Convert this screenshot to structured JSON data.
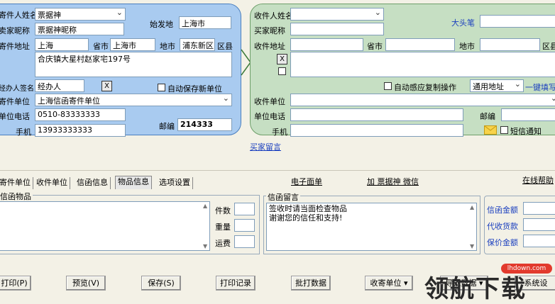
{
  "sender": {
    "name_label": "寄件人姓名",
    "name_value": "票据神",
    "nick_label": "卖家昵称",
    "nick_value": "票据神昵称",
    "origin_label": "始发地",
    "origin_value": "上海市",
    "addr_label": "寄件地址",
    "addr_value": "上海",
    "province_label": "省市",
    "province_value": "上海市",
    "area_label": "地市",
    "area_value": "浦东新区",
    "district_label": "区县",
    "detail_addr": "合庆镇大星村赵家宅197号",
    "handler_label": "经办人签名",
    "handler_value": "经办人",
    "x_label": "X",
    "autosave_label": "自动保存新单位",
    "unit_label": "寄件单位",
    "unit_value": "上海信函寄件单位",
    "phone_label": "单位电话",
    "phone_value": "0510-83333333",
    "mobile_label": "手机",
    "mobile_value": "13933333333",
    "zip_label": "邮编",
    "zip_value": "214333"
  },
  "receiver": {
    "name_label": "收件人姓名",
    "name_value": "",
    "buyer_label": "买家昵称",
    "buyer_value": "",
    "bignose_label": "大头笔",
    "bignose_value": "",
    "addr_label": "收件地址",
    "addr_value": "",
    "province_label": "省市",
    "area_label": "地市",
    "district_label": "区县",
    "x_label": "X",
    "autosense_label": "自动感应复制操作",
    "addr_type_value": "通用地址",
    "fill_link": "一键填写",
    "unit_label": "收件单位",
    "unit_value": "",
    "phone_label": "单位电话",
    "mobile_label": "手机",
    "zip_label": "邮编",
    "sms_label": "短信通知"
  },
  "buyer_message_link": "买家留言",
  "tabs": [
    {
      "label": "寄件单位"
    },
    {
      "label": "收件单位"
    },
    {
      "label": "信函信息"
    },
    {
      "label": "物品信息"
    },
    {
      "label": "选项设置"
    }
  ],
  "top_links": {
    "ewaybill": "电子面单",
    "add_wechat": "加 票据神 微信",
    "online_help": "在线帮助"
  },
  "items_group": {
    "title": "信函物品",
    "count_label": "件数",
    "weight_label": "重量",
    "freight_label": "运费"
  },
  "message_group": {
    "title": "信函留言",
    "line1": "签收时请当面检查物品",
    "line2": "谢谢您的信任和支持!"
  },
  "amounts": {
    "letter_amount": "信函金额",
    "cod_amount": "代收货款",
    "insured_amount": "保价金额"
  },
  "buttons": {
    "print": "打印(P)",
    "preview": "预览(V)",
    "save": "保存(S)",
    "print_record": "打印记录",
    "batch_data": "批打数据",
    "recv_unit": "收寄单位",
    "import_data": "导入数据",
    "system": "系统设"
  },
  "watermark": {
    "text": "领航下载",
    "site": "lhdown.com"
  },
  "colors": {
    "sender_panel": "#a9cbf0",
    "receiver_panel": "#c6dfc3",
    "link_blue": "#1a3fbf"
  }
}
